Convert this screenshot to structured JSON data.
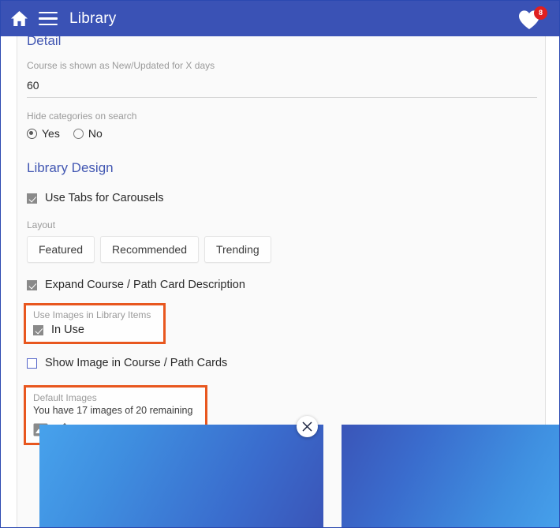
{
  "appbar": {
    "home_icon": "home-icon",
    "menu_icon": "hamburger-menu-icon",
    "title": "Library",
    "favorites_icon": "heart-icon",
    "badge_count": "8"
  },
  "detail_section": {
    "heading": "Detail",
    "new_updated_days": {
      "label": "Course is shown as New/Updated for X days",
      "value": "60"
    },
    "hide_categories": {
      "label": "Hide categories on search",
      "options": [
        {
          "label": "Yes",
          "selected": true
        },
        {
          "label": "No",
          "selected": false
        }
      ]
    }
  },
  "library_design": {
    "heading": "Library Design",
    "use_tabs": {
      "label": "Use Tabs for Carousels",
      "checked": true
    },
    "layout": {
      "label": "Layout",
      "buttons": [
        "Featured",
        "Recommended",
        "Trending"
      ]
    },
    "expand_description": {
      "label": "Expand Course / Path Card Description",
      "checked": true
    },
    "use_images": {
      "label": "Use Images in Library Items",
      "checkbox_label": "In Use",
      "checked": true,
      "highlighted": true
    },
    "show_image_cards": {
      "label": "Show Image in Course / Path Cards",
      "checked": false
    },
    "default_images": {
      "label": "Default Images",
      "note": "You have 17 images of 20 remaining",
      "highlighted": true,
      "tools": [
        {
          "icon": "picture-icon"
        },
        {
          "icon": "upload-icon"
        }
      ]
    }
  },
  "thumbnails": {
    "items": [
      {
        "name": "default-image-thumbnail-1"
      },
      {
        "name": "default-image-thumbnail-2"
      }
    ],
    "close_icon": "close-x-icon"
  },
  "colors": {
    "appbar": "#3a52b5",
    "link": "#4257b2",
    "badge": "#e02020",
    "highlight": "#e8571f",
    "muted_text": "#9a9a9a"
  }
}
